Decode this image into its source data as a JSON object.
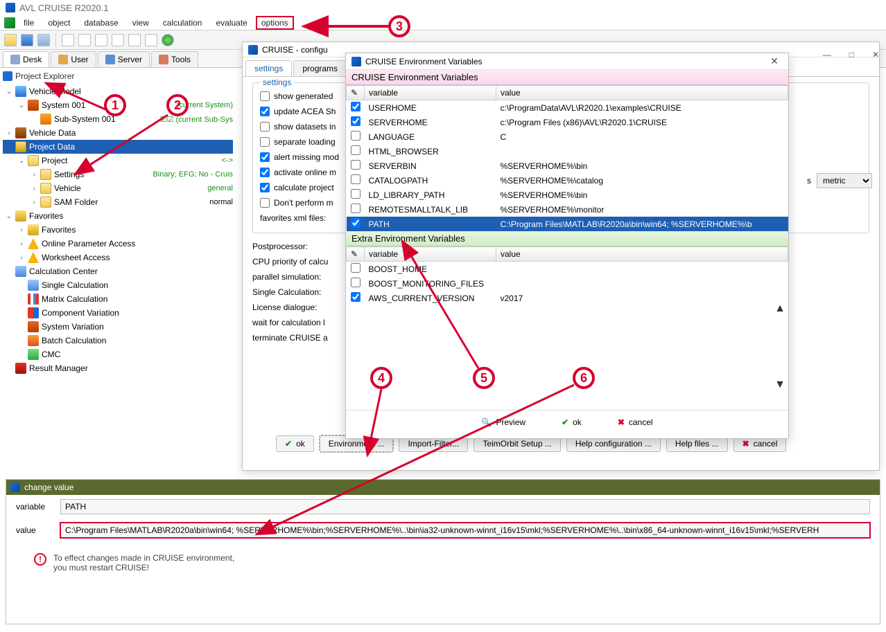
{
  "app": {
    "title": "AVL CRUISE R2020.1"
  },
  "menu": [
    "file",
    "object",
    "database",
    "view",
    "calculation",
    "evaluate",
    "options"
  ],
  "menu_highlight_index": 6,
  "view_tabs": [
    {
      "label": "Desk",
      "active": true
    },
    {
      "label": "User",
      "active": false
    },
    {
      "label": "Server",
      "active": false
    },
    {
      "label": "Tools",
      "active": false
    }
  ],
  "explorer": {
    "title": "Project Explorer",
    "nodes": [
      {
        "exp": "v",
        "ico": "ico-car",
        "label": "Vehicle Model",
        "depth": 0
      },
      {
        "exp": "v",
        "ico": "ico-sys",
        "label": "System 001",
        "badge": "(current System)",
        "badge_cls": "small-gr",
        "depth": 1
      },
      {
        "exp": "",
        "ico": "ico-sub",
        "label": "Sub-System 001",
        "badge": "☑☑ (current Sub-Sys",
        "badge_cls": "small-gr",
        "depth": 2
      },
      {
        "exp": ">",
        "ico": "ico-db",
        "label": "Vehicle Data",
        "depth": 0
      },
      {
        "exp": "v",
        "ico": "ico-proj",
        "label": "Project Data",
        "sel": true,
        "depth": 0
      },
      {
        "exp": "v",
        "ico": "ico-fold",
        "label": "Project",
        "badge": "<->",
        "badge_cls": "green",
        "depth": 1
      },
      {
        "exp": ">",
        "ico": "ico-fold",
        "label": "Settings",
        "badge": "Binary; EFG; No - Cruis",
        "badge_cls": "green",
        "depth": 2
      },
      {
        "exp": ">",
        "ico": "ico-fold",
        "label": "Vehicle",
        "badge": "general",
        "badge_cls": "green",
        "depth": 2
      },
      {
        "exp": ">",
        "ico": "ico-fold",
        "label": "SAM Folder",
        "badge": "normal",
        "badge_cls": "",
        "depth": 2
      },
      {
        "exp": "v",
        "ico": "ico-fav",
        "label": "Favorites",
        "depth": 0
      },
      {
        "exp": ">",
        "ico": "ico-fav",
        "label": "Favorites",
        "depth": 1
      },
      {
        "exp": ">",
        "ico": "ico-warn",
        "label": "Online Parameter Access",
        "depth": 1
      },
      {
        "exp": ">",
        "ico": "ico-warn",
        "label": "Worksheet Access",
        "depth": 1
      },
      {
        "exp": "",
        "ico": "ico-calc",
        "label": "Calculation Center",
        "depth": 0
      },
      {
        "exp": "",
        "ico": "ico-calc",
        "label": "Single Calculation",
        "depth": 1
      },
      {
        "exp": "",
        "ico": "ico-mx",
        "label": "Matrix Calculation",
        "depth": 1
      },
      {
        "exp": "",
        "ico": "ico-comp",
        "label": "Component Variation",
        "depth": 1
      },
      {
        "exp": "",
        "ico": "ico-sys",
        "label": "System Variation",
        "depth": 1
      },
      {
        "exp": "",
        "ico": "ico-batch",
        "label": "Batch Calculation",
        "depth": 1
      },
      {
        "exp": "",
        "ico": "ico-cmc",
        "label": "CMC",
        "depth": 1
      },
      {
        "exp": "",
        "ico": "ico-res",
        "label": "Result Manager",
        "depth": 0
      }
    ]
  },
  "config": {
    "title": "CRUISE - configu",
    "tabs": [
      {
        "label": "settings",
        "active": true
      },
      {
        "label": "programs",
        "active": false
      }
    ],
    "group_label": "settings",
    "checks": [
      {
        "label": "show generated",
        "checked": false
      },
      {
        "label": "update ACEA Sh",
        "checked": true
      },
      {
        "label": "show datasets in",
        "checked": false
      },
      {
        "label": "separate loading",
        "checked": false
      },
      {
        "label": "alert missing mod",
        "checked": true
      },
      {
        "label": "activate online m",
        "checked": true
      },
      {
        "label": "calculate project",
        "checked": true
      },
      {
        "label": "Don't perform m",
        "checked": false
      }
    ],
    "lines": [
      "favorites xml files:",
      "Postprocessor:",
      "CPU priority of calcu",
      "parallel simulation:",
      "Single Calculation:",
      "License dialogue:",
      "wait for calculation l",
      "terminate CRUISE a"
    ],
    "buttons": [
      "ok",
      "Environment ...",
      "Import-Filter...",
      "TeimOrbit Setup ...",
      "Help configuration ...",
      "Help files ...",
      "cancel"
    ]
  },
  "env": {
    "title": "CRUISE Environment Variables",
    "section1": "CRUISE Environment Variables",
    "section2": "Extra Environment Variables",
    "col_var": "variable",
    "col_val": "value",
    "vars": [
      {
        "c": true,
        "n": "USERHOME",
        "v": "c:\\ProgramData\\AVL\\R2020.1\\examples\\CRUISE"
      },
      {
        "c": true,
        "n": "SERVERHOME",
        "v": "c:\\Program Files (x86)\\AVL\\R2020.1\\CRUISE"
      },
      {
        "c": false,
        "n": "LANGUAGE",
        "v": "C"
      },
      {
        "c": false,
        "n": "HTML_BROWSER",
        "v": ""
      },
      {
        "c": false,
        "n": "SERVERBIN",
        "v": "%SERVERHOME%\\bin"
      },
      {
        "c": false,
        "n": "CATALOGPATH",
        "v": "%SERVERHOME%\\catalog"
      },
      {
        "c": false,
        "n": "LD_LIBRARY_PATH",
        "v": "%SERVERHOME%\\bin"
      },
      {
        "c": false,
        "n": "REMOTESMALLTALK_LIB",
        "v": "%SERVERHOME%\\monitor"
      },
      {
        "c": true,
        "n": "PATH",
        "v": "C:\\Program Files\\MATLAB\\R2020a\\bin\\win64; %SERVERHOME%\\b",
        "sel": true
      }
    ],
    "extras": [
      {
        "c": false,
        "n": "BOOST_HOME",
        "v": ""
      },
      {
        "c": false,
        "n": "BOOST_MONITORING_FILES",
        "v": ""
      },
      {
        "c": true,
        "n": "AWS_CURRENT_VERSION",
        "v": "v2017"
      }
    ],
    "btn_preview": "Preview",
    "btn_ok": "ok",
    "btn_cancel": "cancel"
  },
  "change": {
    "title": "change value",
    "lbl_variable": "variable",
    "lbl_value": "value",
    "variable": "PATH",
    "value": "C:\\Program Files\\MATLAB\\R2020a\\bin\\win64; %SERVERHOME%\\bin;%SERVERHOME%\\..\\bin\\ia32-unknown-winnt_i16v15\\mkl;%SERVERHOME%\\..\\bin\\x86_64-unknown-winnt_i16v15\\mkl;%SERVERH",
    "notice1": "To effect changes made in CRUISE environment,",
    "notice2": "you must restart CRUISE!"
  },
  "metric": {
    "label": "s",
    "value": "metric"
  },
  "annotations": [
    "1",
    "2",
    "3",
    "4",
    "5",
    "6"
  ]
}
